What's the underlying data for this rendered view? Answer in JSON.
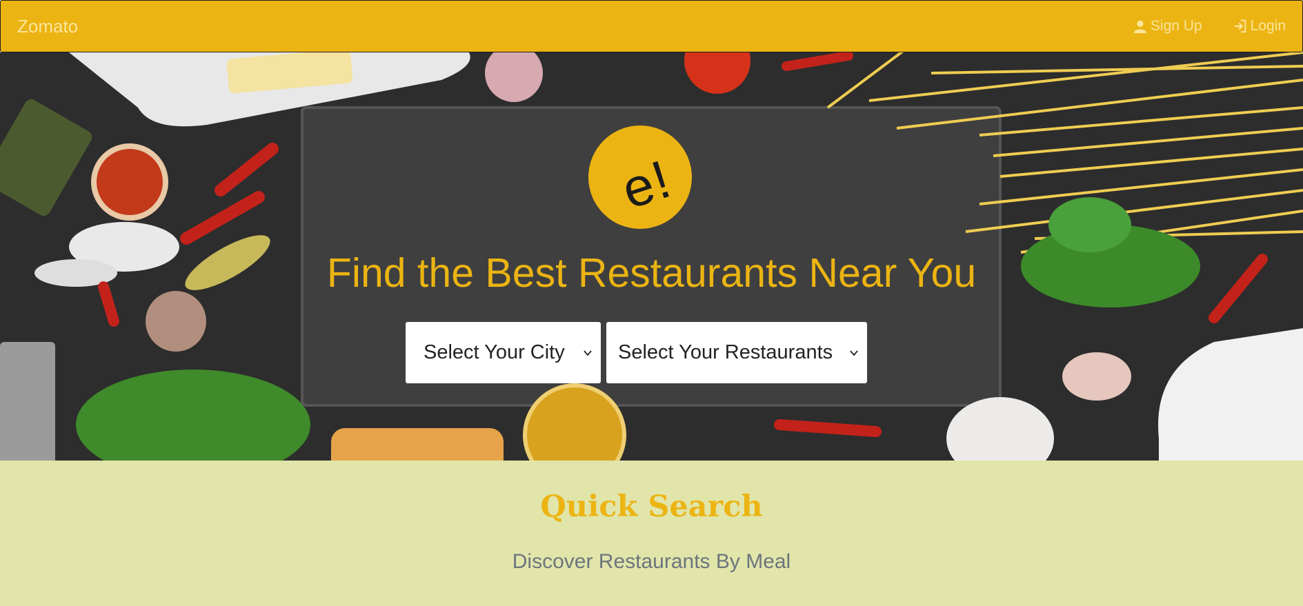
{
  "navbar": {
    "brand": "Zomato",
    "signup_label": "Sign Up",
    "login_label": "Login",
    "signup_icon": "user-icon",
    "login_icon": "log-in-icon",
    "bg_color": "#ecb413"
  },
  "hero": {
    "logo_text": "e!",
    "title": "Find the Best Restaurants Near You",
    "city_select": {
      "selected": "Select Your City"
    },
    "restaurant_select": {
      "selected": "Select Your Restaurants"
    },
    "accent_color": "#ecb413"
  },
  "quick_search": {
    "title": "Quick Search",
    "subtitle": "Discover Restaurants By Meal",
    "bg_color": "#e1e5aa"
  }
}
